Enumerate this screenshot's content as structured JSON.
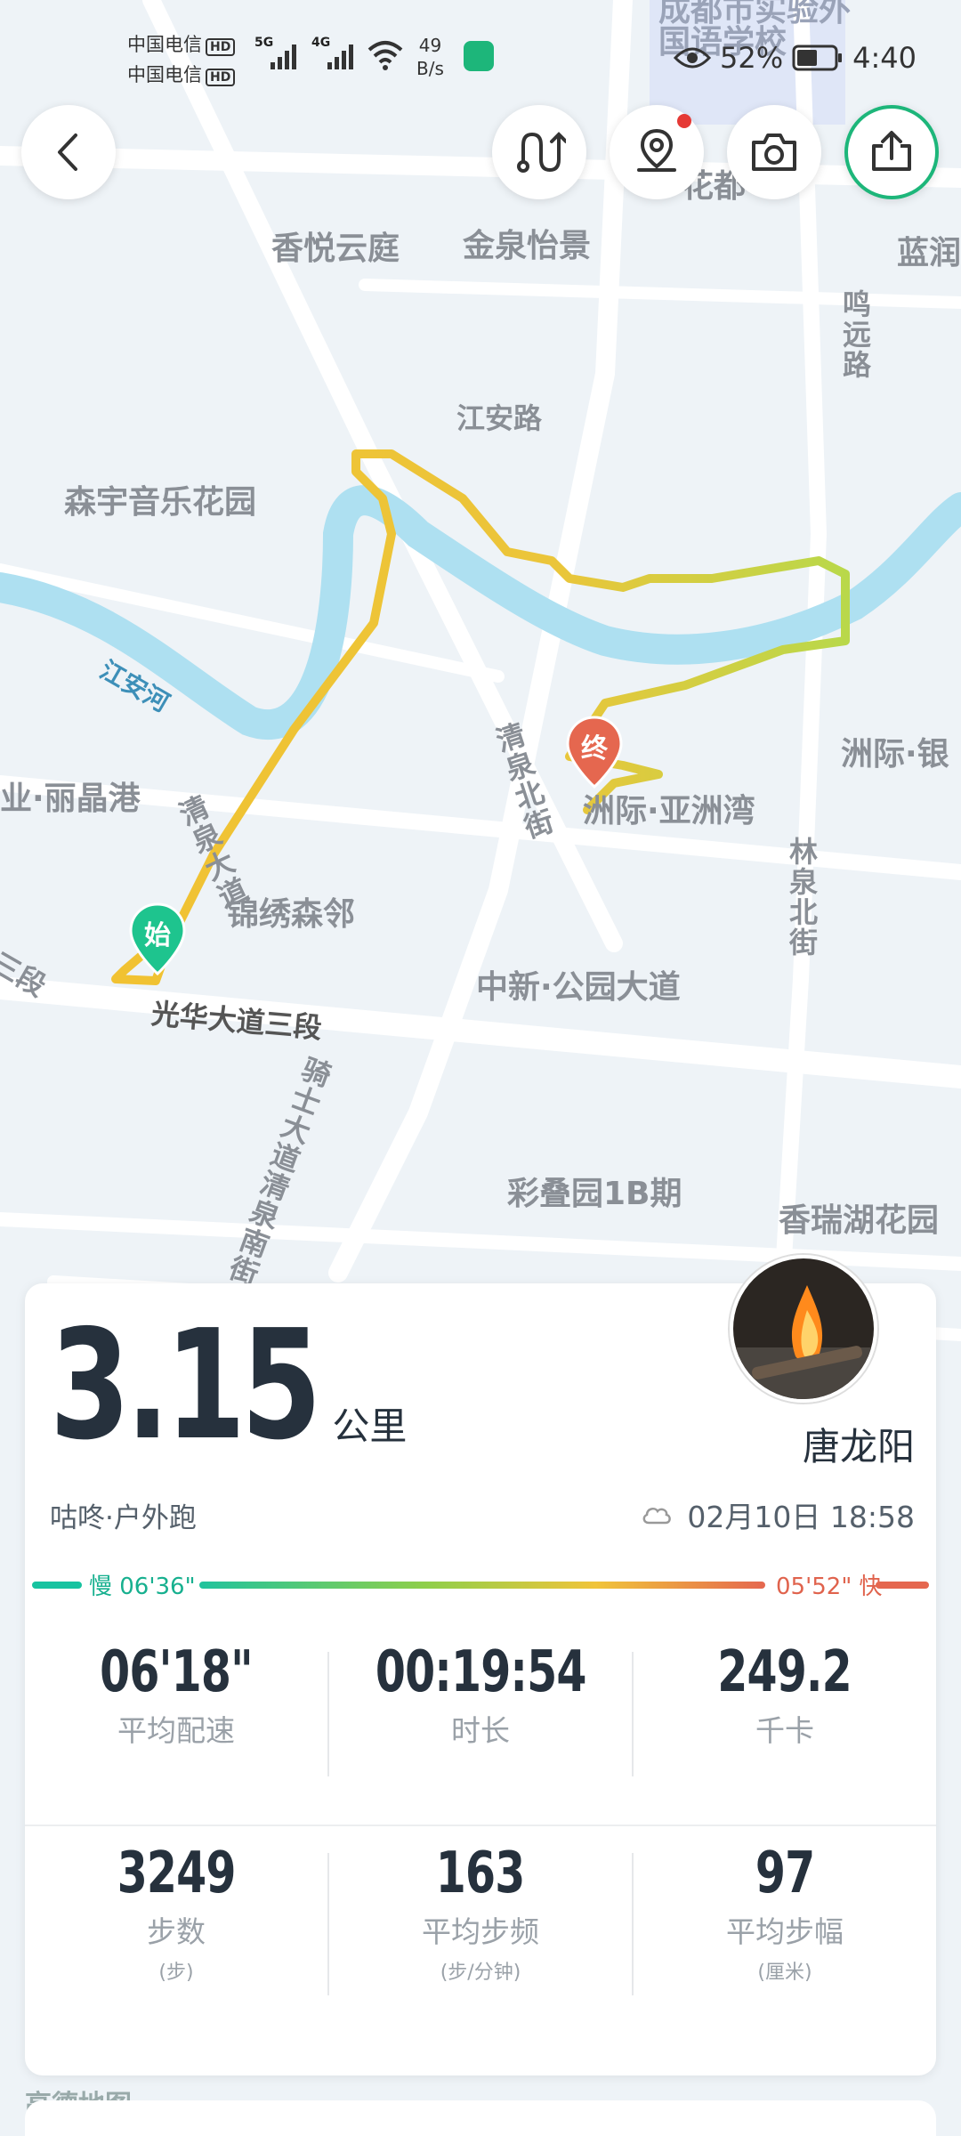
{
  "status_bar": {
    "carrier_1": "中国电信",
    "carrier_2": "中国电信",
    "hd": "HD",
    "net_5g": "5G",
    "net_4g": "4G",
    "net_speed_value": "49",
    "net_speed_unit": "B/s",
    "battery": "52%",
    "time": "4:40"
  },
  "map": {
    "labels": {
      "school": "成都市实验外国语学校",
      "xiangyue": "香悦云庭",
      "jinquan": "金泉怡景",
      "lanrun": "蓝润",
      "mingyuan_road": "鸣远路",
      "jiangan_road": "江安路",
      "senyu": "森宇音乐花园",
      "jiangan_river": "江安河",
      "lijing": "业·丽晶港",
      "qingquan_north": "清泉北街",
      "zhouji_yazhou": "洲际·亚洲湾",
      "zhouji": "洲际·银",
      "linquan_north": "林泉北街",
      "jinxiu": "锦绣森邻",
      "zhongxin": "中新·公园大道",
      "guanghua": "光华大道三段",
      "guanghua_left": "三段",
      "qishi": "骑士大道清泉南街",
      "caidieyuan": "彩叠园1B期",
      "xiangrui": "香瑞湖花园",
      "huadu": "花都",
      "start_marker": "始",
      "end_marker": "终",
      "qingquan_da": "清泉大道"
    },
    "route_colors": {
      "start": "#f1c232",
      "end": "#b9d84a"
    }
  },
  "top_buttons": {
    "back": "back-icon",
    "route": "route-icon",
    "location": "location-icon",
    "camera": "camera-icon",
    "share": "share-icon"
  },
  "summary": {
    "distance": "3.15",
    "distance_unit": "公里",
    "user_name": "唐龙阳",
    "activity_type": "咕咚·户外跑",
    "datetime": "02月10日 18:58",
    "pace_slow": "慢 06'36\"",
    "pace_fast": "05'52\" 快"
  },
  "stats": [
    {
      "value": "06'18\"",
      "label": "平均配速",
      "unit": ""
    },
    {
      "value": "00:19:54",
      "label": "时长",
      "unit": ""
    },
    {
      "value": "249.2",
      "label": "千卡",
      "unit": ""
    },
    {
      "value": "3249",
      "label": "步数",
      "unit": "(步)"
    },
    {
      "value": "163",
      "label": "平均步频",
      "unit": "(步/分钟)"
    },
    {
      "value": "97",
      "label": "平均步幅",
      "unit": "(厘米)"
    }
  ],
  "footer": {
    "map_provider": "高德地图"
  },
  "colors": {
    "accent_green": "#1db67a",
    "text_dark": "#26313d",
    "marker_red": "#e5674f"
  }
}
